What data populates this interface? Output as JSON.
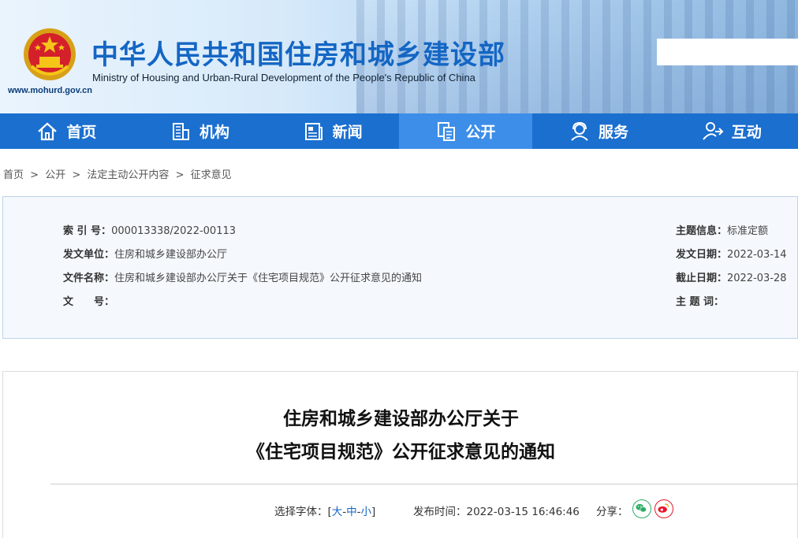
{
  "header": {
    "title": "中华人民共和国住房和城乡建设部",
    "subtitle": "Ministry of Housing and Urban-Rural Development of the People's Republic of China",
    "url": "www.mohurd.gov.cn",
    "emblem": "national-emblem-icon"
  },
  "nav": [
    {
      "label": "首页",
      "icon": "home-icon"
    },
    {
      "label": "机构",
      "icon": "building-icon"
    },
    {
      "label": "新闻",
      "icon": "newspaper-icon"
    },
    {
      "label": "公开",
      "icon": "document-icon",
      "active": true
    },
    {
      "label": "服务",
      "icon": "service-person-icon"
    },
    {
      "label": "互动",
      "icon": "interaction-icon"
    }
  ],
  "breadcrumb": [
    "首页",
    ">",
    "公开",
    ">",
    "法定主动公开内容",
    ">",
    "征求意见"
  ],
  "info": {
    "index_label": "索 引 号：",
    "index_value": "000013338/2022-00113",
    "issuer_label": "发文单位：",
    "issuer_value": "住房和城乡建设部办公厅",
    "filename_label": "文件名称：",
    "filename_value": "住房和城乡建设部办公厅关于《住宅项目规范》公开征求意见的通知",
    "docno_label": "文　　号：",
    "docno_value": "",
    "topic_label": "主题信息：",
    "topic_value": "标准定额",
    "date_label": "发文日期：",
    "date_value": "2022-03-14",
    "deadline_label": "截止日期：",
    "deadline_value": "2022-03-28",
    "keywords_label": "主 题 词：",
    "keywords_value": ""
  },
  "article": {
    "title_line1": "住房和城乡建设部办公厅关于",
    "title_line2": "《住宅项目规范》公开征求意见的通知",
    "font_label": "选择字体：[",
    "font_large": "大",
    "font_sep1": "-",
    "font_medium": "中",
    "font_sep2": "-",
    "font_small": "小",
    "font_close": "]",
    "publish_label": "发布时间：",
    "publish_value": "2022-03-15 16:46:46",
    "share_label": "分享：",
    "share_wechat": "wechat-icon",
    "share_weibo": "weibo-icon"
  },
  "colors": {
    "primary": "#1b6fcf",
    "active": "#3d8ee8",
    "title": "#1466c4",
    "wechat": "#2aae67",
    "weibo": "#e6162d"
  }
}
